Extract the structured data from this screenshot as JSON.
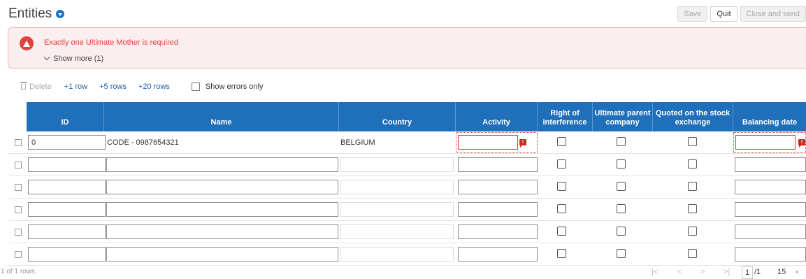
{
  "header": {
    "title": "Entities",
    "buttons": {
      "save": "Save",
      "quit": "Quit",
      "close_send": "Close and send"
    }
  },
  "error": {
    "message": "Exactly one Ultimate Mother is required",
    "show_more": "Show more (1)"
  },
  "toolbar": {
    "delete": "Delete",
    "add1": "+1 row",
    "add5": "+5 rows",
    "add20": "+20 rows",
    "show_errors": "Show errors only"
  },
  "table": {
    "columns": [
      "ID",
      "Name",
      "Country",
      "Activity",
      "Right of interference",
      "Ultimate parent company",
      "Quoted on the stock exchange",
      "Balancing date"
    ],
    "rows": [
      {
        "id": "0",
        "name": "CODE - 0987654321",
        "country": "BELGIUM",
        "activity": "",
        "balancing_date": ""
      },
      {
        "id": "",
        "name": "",
        "country": "",
        "activity": "",
        "balancing_date": ""
      },
      {
        "id": "",
        "name": "",
        "country": "",
        "activity": "",
        "balancing_date": ""
      },
      {
        "id": "",
        "name": "",
        "country": "",
        "activity": "",
        "balancing_date": ""
      },
      {
        "id": "",
        "name": "",
        "country": "",
        "activity": "",
        "balancing_date": ""
      },
      {
        "id": "",
        "name": "",
        "country": "",
        "activity": "",
        "balancing_date": ""
      }
    ]
  },
  "footer": {
    "row_count": "1 of 1 rows.",
    "page": "1",
    "total_pages": "/1",
    "page_size": "15"
  },
  "colors": {
    "header_blue": "#1f6fba",
    "error_red": "#e0423f",
    "link_blue": "#1a5fa8"
  }
}
